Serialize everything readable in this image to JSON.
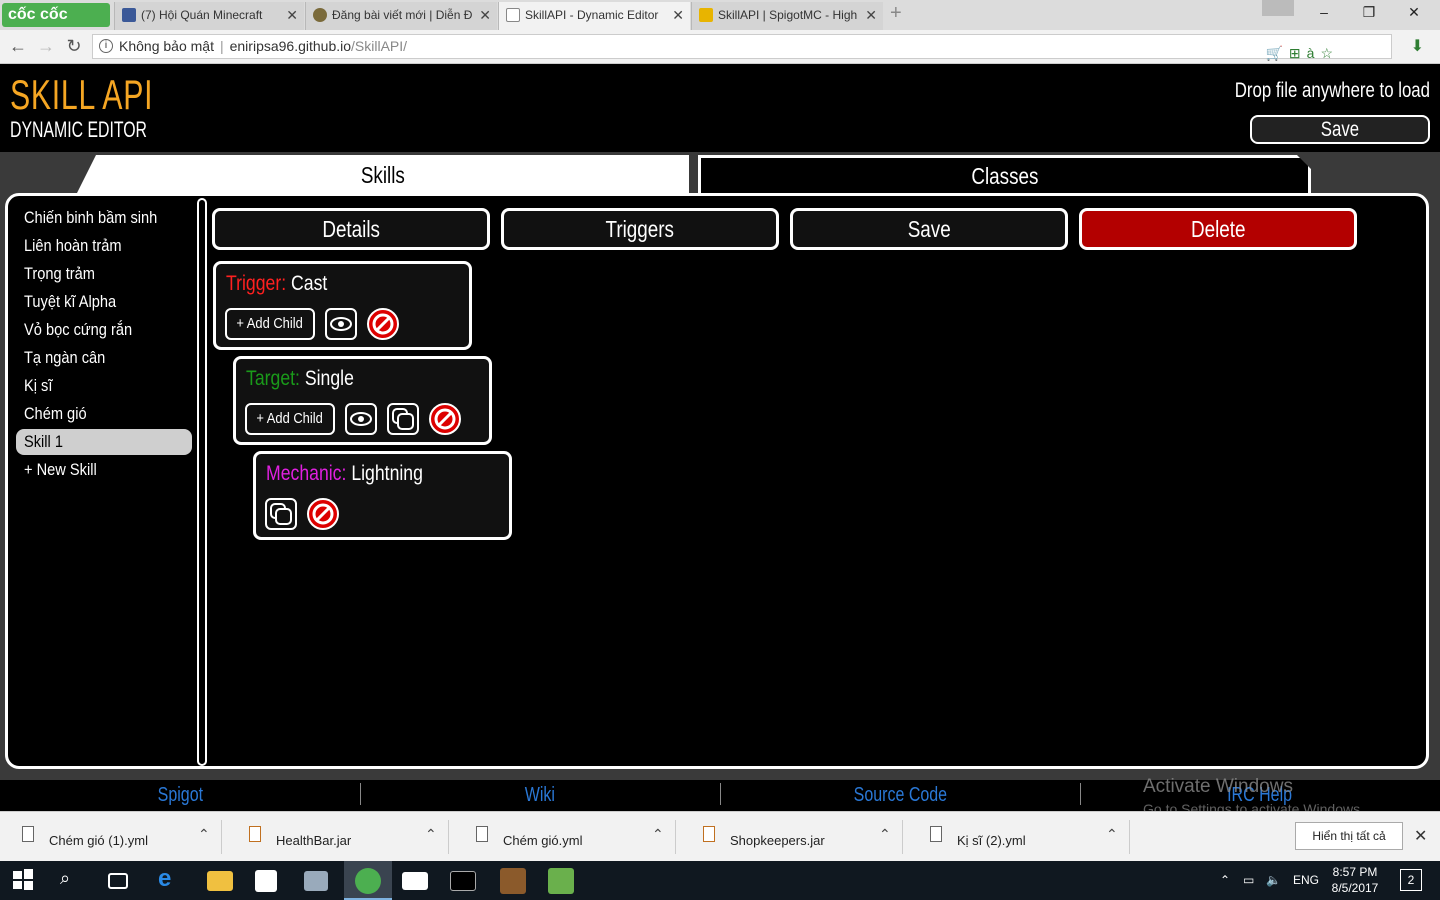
{
  "browser": {
    "logo": "cốc cốc",
    "tabs": [
      {
        "title": "(7) Hội Quán Minecraft",
        "color": "#3b5998"
      },
      {
        "title": "Đăng bài viết mới | Diễn Đ",
        "color": "#7a6a3a"
      },
      {
        "title": "SkillAPI - Dynamic Editor",
        "color": "#ffffff"
      },
      {
        "title": "SkillAPI | SpigotMC - High",
        "color": "#e8b400"
      }
    ],
    "new_tab": "+",
    "window_controls": [
      "–",
      "❐",
      "✕"
    ],
    "security": "Không bảo mật",
    "url_host": "eniripsa96.github.io",
    "url_path": "/SkillAPI/"
  },
  "header": {
    "logo_main": "SKILL API",
    "logo_sub": "DYNAMIC EDITOR",
    "drop_hint": "Drop file anywhere to load",
    "save_label": "Save"
  },
  "main_tabs": {
    "skills": "Skills",
    "classes": "Classes"
  },
  "skills": [
    "Chiến binh bầm sinh",
    "Liên hoàn trảm",
    "Trọng trảm",
    "Tuyệt kĩ Alpha",
    "Vỏ bọc cứng rắn",
    "Tạ ngàn cân",
    "Kị sĩ",
    "Chém gió",
    "Skill 1",
    "+ New Skill"
  ],
  "actions": {
    "details": "Details",
    "triggers": "Triggers",
    "save": "Save",
    "delete": "Delete",
    "delete_color": "#b30000"
  },
  "nodes": [
    {
      "type": "Trigger:",
      "name": "Cast",
      "type_color": "#ff2020",
      "add_child": "+ Add Child"
    },
    {
      "type": "Target:",
      "name": "Single",
      "type_color": "#1a9a1a",
      "add_child": "+ Add Child"
    },
    {
      "type": "Mechanic:",
      "name": "Lightning",
      "type_color": "#e020e0"
    }
  ],
  "footer": {
    "links": [
      "Spigot",
      "Wiki",
      "Source Code",
      "IRC Help"
    ],
    "link_color": "#2a78d6"
  },
  "watermark": {
    "line1": "Activate Windows",
    "line2": "Go to Settings to activate Windows."
  },
  "downloads": {
    "items": [
      "Chém gió (1).yml",
      "HealthBar.jar",
      "Chém gió.yml",
      "Shopkeepers.jar",
      "Kị sĩ (2).yml"
    ],
    "show_all": "Hiển thị tất cả"
  },
  "taskbar": {
    "lang": "ENG",
    "time": "8:57 PM",
    "date": "8/5/2017",
    "notifications": "2"
  }
}
